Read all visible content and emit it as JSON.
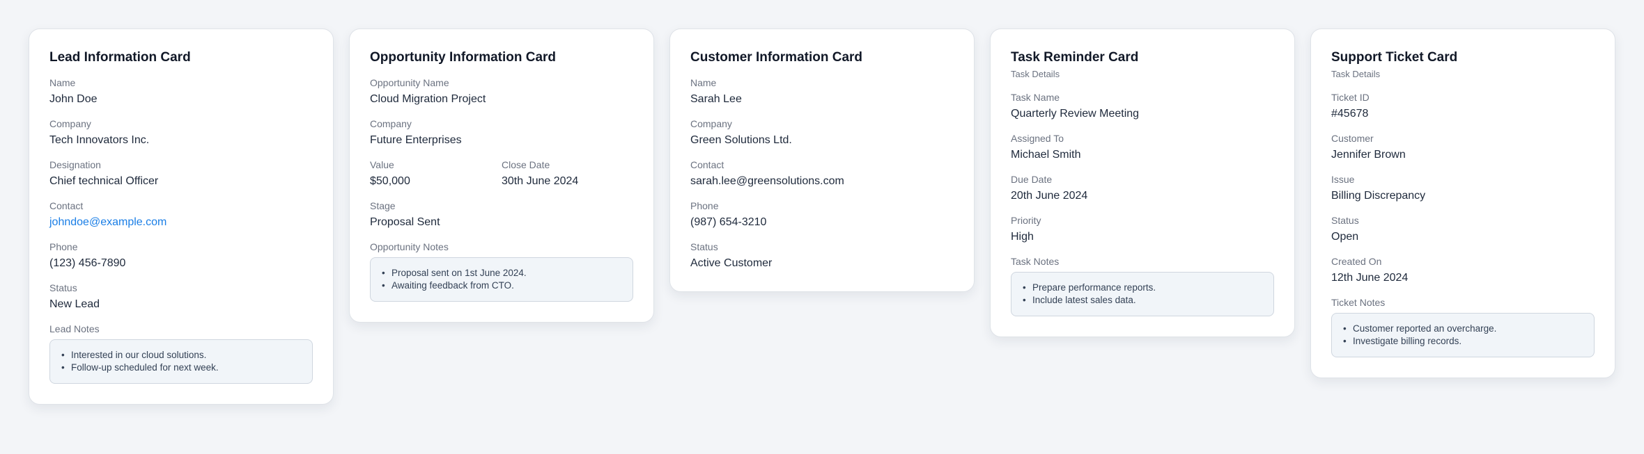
{
  "lead": {
    "title": "Lead Information Card",
    "fields": [
      {
        "label": "Name",
        "value": "John Doe"
      },
      {
        "label": "Company",
        "value": "Tech Innovators Inc."
      },
      {
        "label": "Designation",
        "value": "Chief technical Officer"
      },
      {
        "label": "Contact",
        "value": "johndoe@example.com"
      },
      {
        "label": "Phone",
        "value": "(123) 456-7890"
      },
      {
        "label": "Status",
        "value": "New Lead"
      }
    ],
    "notes_label": "Lead Notes",
    "notes": [
      "Interested in our cloud solutions.",
      "Follow-up scheduled for next week."
    ]
  },
  "opportunity": {
    "title": "Opportunity Information Card",
    "fields": [
      {
        "label": "Opportunity Name",
        "value": "Cloud Migration Project"
      },
      {
        "label": "Company",
        "value": "Future Enterprises"
      },
      {
        "label": "Value",
        "value": "$50,000"
      },
      {
        "label": "Close Date",
        "value": "30th June 2024"
      },
      {
        "label": "Stage",
        "value": "Proposal Sent"
      }
    ],
    "notes_label": "Opportunity Notes",
    "notes": [
      "Proposal sent on 1st June 2024.",
      "Awaiting feedback from CTO."
    ]
  },
  "customer": {
    "title": "Customer Information Card",
    "fields": [
      {
        "label": "Name",
        "value": "Sarah Lee"
      },
      {
        "label": "Company",
        "value": "Green Solutions Ltd."
      },
      {
        "label": "Contact",
        "value": "sarah.lee@greensolutions.com"
      },
      {
        "label": "Phone",
        "value": "(987) 654-3210"
      },
      {
        "label": "Status",
        "value": "Active Customer"
      }
    ]
  },
  "task": {
    "title": "Task Reminder Card",
    "subtitle": "Task Details",
    "fields": [
      {
        "label": "Task Name",
        "value": "Quarterly Review Meeting"
      },
      {
        "label": "Assigned To",
        "value": "Michael Smith"
      },
      {
        "label": "Due Date",
        "value": "20th June 2024"
      },
      {
        "label": "Priority",
        "value": "High"
      }
    ],
    "notes_label": "Task Notes",
    "notes": [
      "Prepare performance reports.",
      "Include latest sales data."
    ]
  },
  "ticket": {
    "title": "Support Ticket Card",
    "subtitle": "Task Details",
    "fields": [
      {
        "label": "Ticket ID",
        "value": "#45678"
      },
      {
        "label": "Customer",
        "value": "Jennifer Brown"
      },
      {
        "label": "Issue",
        "value": "Billing Discrepancy"
      },
      {
        "label": "Status",
        "value": "Open"
      },
      {
        "label": "Created On",
        "value": "12th June 2024"
      }
    ],
    "notes_label": "Ticket Notes",
    "notes": [
      "Customer reported an overcharge.",
      "Investigate billing records."
    ]
  },
  "colors": {
    "link": "#1a7ee6",
    "background": "#f3f5f8",
    "notes_bg": "#f1f5f9"
  }
}
